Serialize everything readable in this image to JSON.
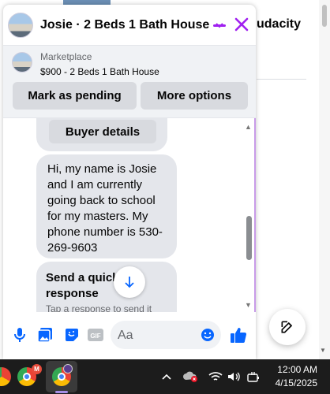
{
  "background": {
    "heading": "udacity"
  },
  "chat": {
    "header": {
      "title": "Josie · 2 Beds 1 Bath House"
    },
    "listing": {
      "label": "Marketplace",
      "price_title": "$900 - 2 Beds 1 Bath House",
      "mark_pending": "Mark as pending",
      "more_options": "More options"
    },
    "messages": {
      "buyer_details": "Buyer details",
      "message_text": "Hi, my name is Josie and I am currently going back to school for my masters. My phone number is 530-269-9603",
      "quick_response_title": "Send a quick response",
      "quick_response_sub": "Tap a response to send it"
    },
    "composer": {
      "placeholder": "Aa",
      "gif_label": "GIF"
    }
  },
  "taskbar": {
    "badge": "M",
    "time": "12:00 AM",
    "date": "4/15/2025"
  },
  "colors": {
    "accent": "#0866ff",
    "close_accent": "#a020f0",
    "bubble": "#e4e6eb"
  }
}
